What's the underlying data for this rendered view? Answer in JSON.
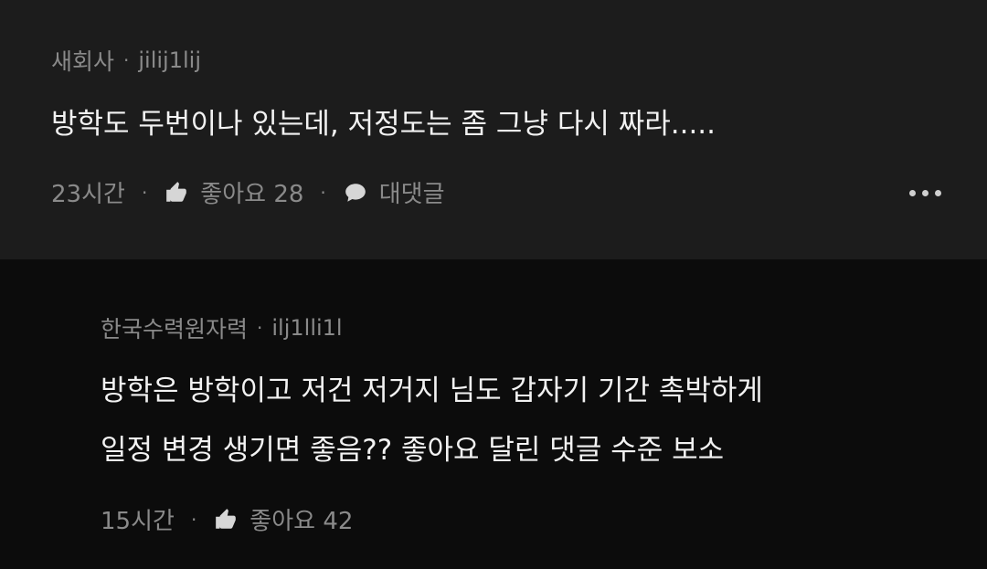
{
  "comments": [
    {
      "author": "새회사",
      "separator": "·",
      "handle": "jilij1lij",
      "text_lines": [
        "방학도 두번이나 있는데, 저정도는 좀 그냥 다시 짜라....."
      ],
      "time": "23시간",
      "like_label": "좋아요 28",
      "reply_label": "대댓글",
      "like_icon": "thumbs-up-icon",
      "reply_icon": "speech-bubble-icon",
      "more_icon": "more-options-icon"
    },
    {
      "author": "한국수력원자력",
      "separator": "·",
      "handle": "ilj1lli1l",
      "text_lines": [
        "방학은 방학이고 저건 저거지 님도 갑자기 기간 촉박하게",
        "일정 변경 생기면 좋음?? 좋아요 달린 댓글 수준 보소"
      ],
      "time": "15시간",
      "like_label": "좋아요 42",
      "like_icon": "thumbs-up-icon"
    }
  ],
  "colors": {
    "background": "#0c0c0c",
    "card": "#1c1c1c",
    "meta_text": "#8a8a8a",
    "body_text": "#f2f2f2"
  }
}
